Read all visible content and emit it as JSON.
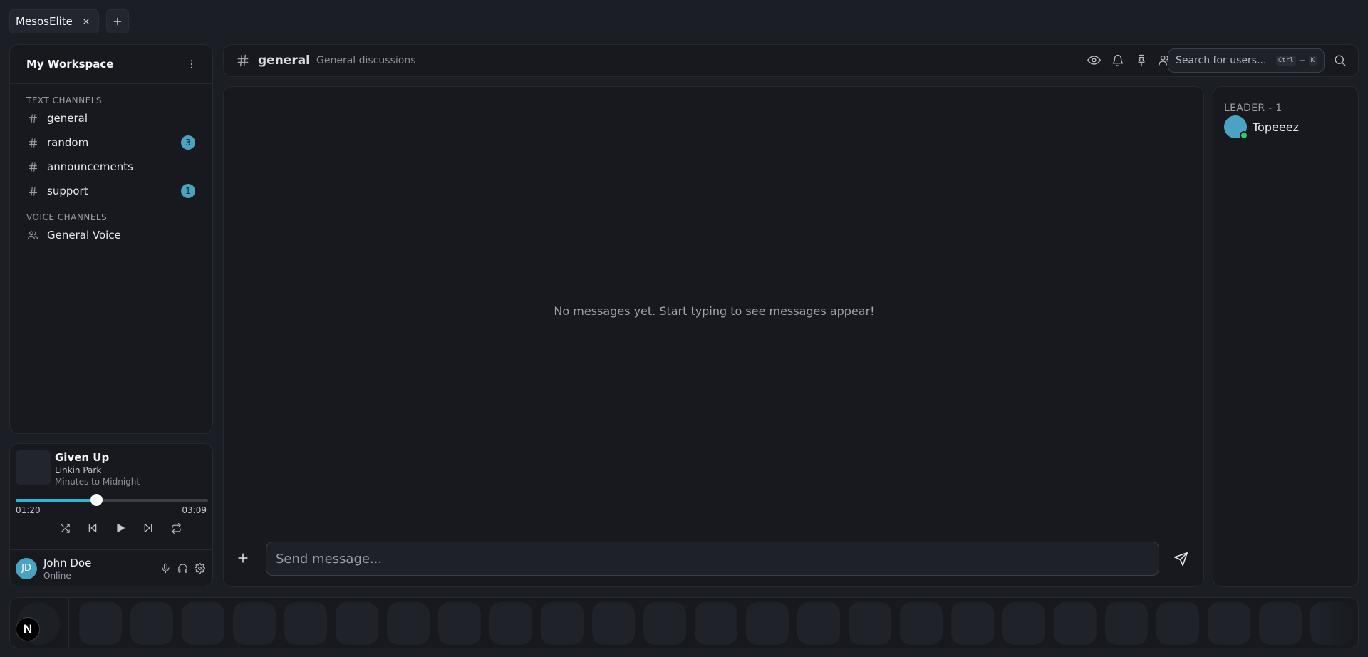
{
  "tabs": [
    {
      "label": "MesosElite",
      "close_icon": "close-icon"
    }
  ],
  "sidebar": {
    "workspace_title": "My Workspace",
    "text_channels_label": "TEXT CHANNELS",
    "text_channels": [
      {
        "label": "general",
        "badge": ""
      },
      {
        "label": "random",
        "badge": "3"
      },
      {
        "label": "announcements",
        "badge": ""
      },
      {
        "label": "support",
        "badge": "1"
      }
    ],
    "voice_channels_label": "VOICE CHANNELS",
    "voice_channels": [
      {
        "label": "General Voice"
      }
    ]
  },
  "player": {
    "title": "Given Up",
    "artist": "Linkin Park",
    "album": "Minutes to Midnight",
    "current_time": "01:20",
    "total_time": "03:09",
    "progress": 0.42
  },
  "user": {
    "initials": "JD",
    "name": "John Doe",
    "status": "Online"
  },
  "channel_header": {
    "name": "general",
    "description": "General discussions",
    "search_placeholder": "Search for users...",
    "shortcut_key1": "Ctrl",
    "shortcut_plus": "+",
    "shortcut_key2": "K"
  },
  "chat": {
    "empty_message": "No messages yet. Start typing to see messages appear!",
    "composer_placeholder": "Send message..."
  },
  "members": {
    "group_label": "LEADER - 1",
    "list": [
      {
        "name": "Topeeez",
        "status_color": "#2ecc71"
      }
    ]
  },
  "dock": {
    "logo_letter": "N",
    "slot_count": 25
  },
  "colors": {
    "accent": "#4aa3c2",
    "progress": "#2fb5d6",
    "online": "#2ecc71",
    "background": "#1b1e25",
    "panel": "#17191e"
  }
}
